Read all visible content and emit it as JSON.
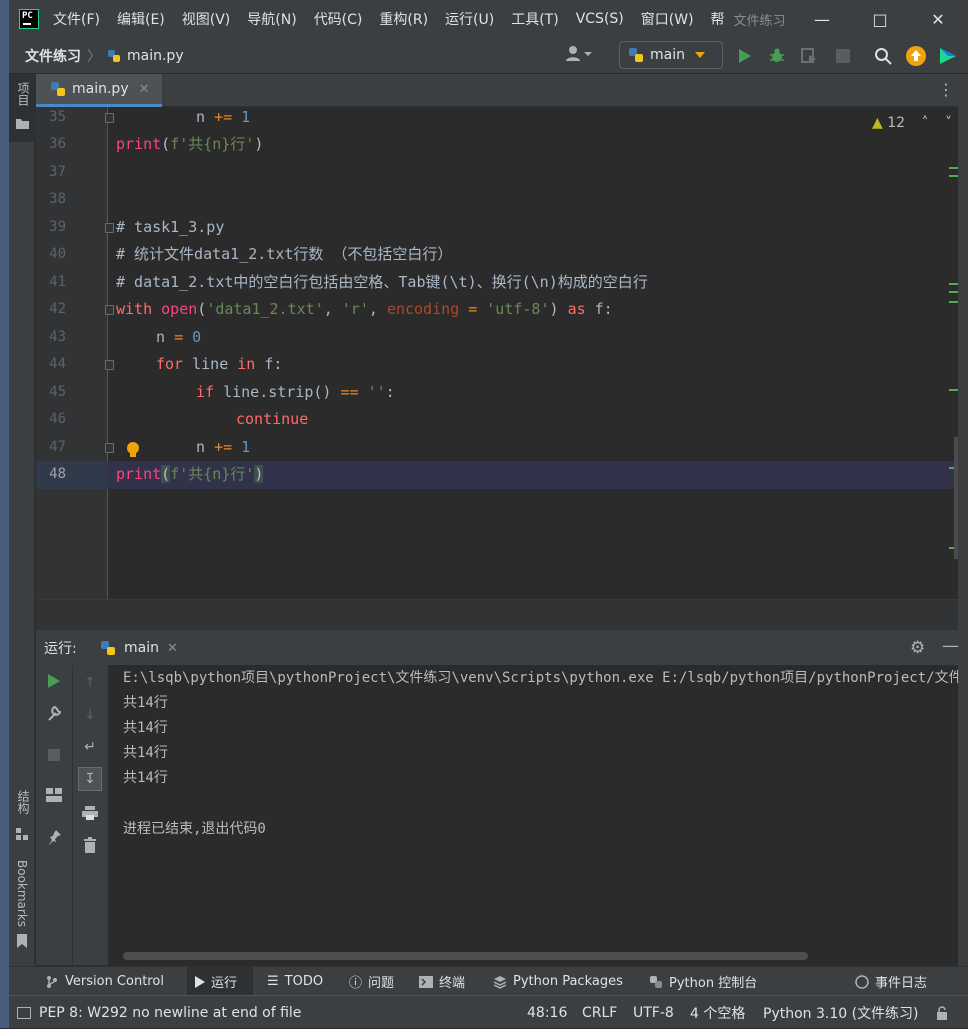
{
  "titlebar": {
    "app_logo": "PC",
    "menus": [
      "文件(F)",
      "编辑(E)",
      "视图(V)",
      "导航(N)",
      "代码(C)",
      "重构(R)",
      "运行(U)",
      "工具(T)",
      "VCS(S)",
      "窗口(W)",
      "帮"
    ],
    "window_title": "文件练习"
  },
  "navbar": {
    "project": "文件练习",
    "file": "main.py",
    "run_config": "main"
  },
  "sidebar": {
    "project_label": "项目",
    "structure_label": "结构",
    "bookmarks_label": "Bookmarks"
  },
  "editor": {
    "tab": "main.py",
    "warning_count": "12",
    "line_numbers": [
      "35",
      "36",
      "37",
      "38",
      "39",
      "40",
      "41",
      "42",
      "43",
      "44",
      "45",
      "46",
      "47",
      "48"
    ],
    "comment_39": "# task1_3.py",
    "comment_40": "# 统计文件data1_2.txt行数 （不包括空白行）",
    "comment_41": "# data1_2.txt中的空白行包括由空格、Tab键(\\t)、换行(\\n)构成的空白行",
    "print_str": "f'共{n}行'",
    "open_file": "'data1_2.txt'",
    "open_mode": "'r'",
    "open_enc": "'utf-8'",
    "empty_str": "''"
  },
  "run_panel": {
    "label": "运行:",
    "tab": "main",
    "output": [
      "E:\\lsqb\\python项目\\pythonProject\\文件练习\\venv\\Scripts\\python.exe E:/lsqb/python项目/pythonProject/文件练习/main.py",
      "共14行",
      "共14行",
      "共14行",
      "共14行",
      "",
      "进程已结束,退出代码0"
    ]
  },
  "tool_windows": {
    "version_control": "Version Control",
    "run": "运行",
    "todo": "TODO",
    "problems": "问题",
    "terminal": "终端",
    "python_packages": "Python Packages",
    "python_console": "Python 控制台",
    "event_log": "事件日志"
  },
  "statusbar": {
    "message": "PEP 8: W292 no newline at end of file",
    "position": "48:16",
    "line_sep": "CRLF",
    "encoding": "UTF-8",
    "indent": "4 个空格",
    "interpreter": "Python 3.10 (文件练习)"
  },
  "colors": {
    "accent": "#4a88c7",
    "run_green": "#499c54",
    "keyword": "#ff6b68",
    "string": "#6a8759",
    "number": "#6897bb"
  }
}
